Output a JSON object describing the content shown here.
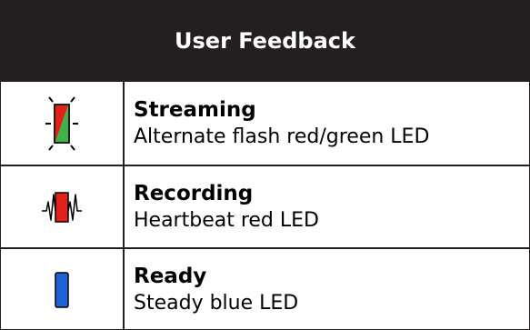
{
  "header": {
    "title": "User Feedback"
  },
  "rows": [
    {
      "title": "Streaming",
      "description": "Alternate flash red/green LED",
      "icon": "flashing-red-green-led-icon"
    },
    {
      "title": "Recording",
      "description": "Heartbeat red LED",
      "icon": "heartbeat-red-led-icon"
    },
    {
      "title": "Ready",
      "description": "Steady blue LED",
      "icon": "steady-blue-led-icon"
    }
  ],
  "colors": {
    "header_bg": "#231f20",
    "red": "#e3211b",
    "green": "#3cb44a",
    "blue": "#1f63d8"
  }
}
